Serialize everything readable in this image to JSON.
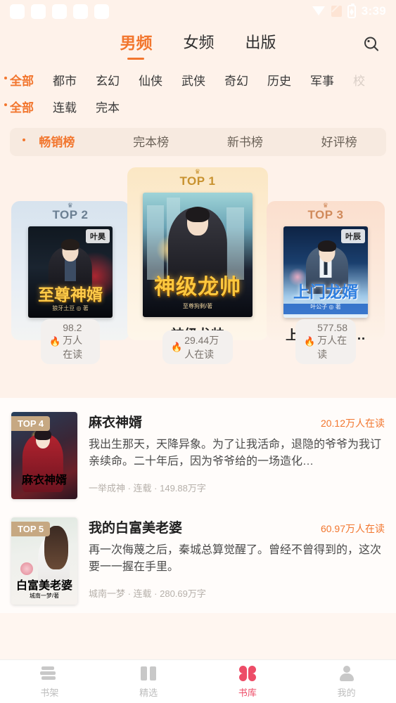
{
  "statusbar": {
    "time": "3:39",
    "placeholder_count": 5,
    "icons": [
      "wifi-icon",
      "signal-icon",
      "battery-charging-icon"
    ]
  },
  "header": {
    "tabs": [
      {
        "label": "男频",
        "active": true
      },
      {
        "label": "女频",
        "active": false
      },
      {
        "label": "出版",
        "active": false
      }
    ],
    "search_icon": "search-icon"
  },
  "filters": {
    "genre_row": [
      {
        "label": "全部",
        "selected": true
      },
      {
        "label": "都市",
        "selected": false
      },
      {
        "label": "玄幻",
        "selected": false
      },
      {
        "label": "仙侠",
        "selected": false
      },
      {
        "label": "武侠",
        "selected": false
      },
      {
        "label": "奇幻",
        "selected": false
      },
      {
        "label": "历史",
        "selected": false
      },
      {
        "label": "军事",
        "selected": false
      },
      {
        "label": "校",
        "selected": false,
        "clipped": true
      }
    ],
    "status_row": [
      {
        "label": "全部",
        "selected": true
      },
      {
        "label": "连载",
        "selected": false
      },
      {
        "label": "完本",
        "selected": false
      }
    ]
  },
  "rank_tabs": [
    {
      "label": "畅销榜",
      "selected": true
    },
    {
      "label": "完本榜",
      "selected": false
    },
    {
      "label": "新书榜",
      "selected": false
    },
    {
      "label": "好评榜",
      "selected": false
    }
  ],
  "podium": [
    {
      "rank_label": "TOP 2",
      "title": "至尊神婿",
      "author_badge": "叶昊",
      "cover_title": "至尊神婿",
      "cover_sub": "狼牙土豆 ◎ 著",
      "heat": "98.2万人在读"
    },
    {
      "rank_label": "TOP 1",
      "title": "神级龙帅",
      "author_badge": "",
      "cover_title": "神级龙帅",
      "cover_sub": "至尊狗剩/著",
      "heat": "29.44万人在读"
    },
    {
      "rank_label": "TOP 3",
      "title": "上门龙婿（…",
      "author_badge": "叶辰",
      "cover_title": "上门龙婿",
      "cover_sub": "叶公子 ◎ 著",
      "heat": "577.58万人在读"
    }
  ],
  "list": [
    {
      "badge": "TOP 4",
      "title": "麻衣神婿",
      "heat": "20.12万人在读",
      "desc": "我出生那天，天降异象。为了让我活命，退隐的爷爷为我订亲续命。二十年后，因为爷爷给的一场造化…",
      "meta": "一举成神 · 连载 · 149.88万字",
      "cover_title": "麻衣神婿"
    },
    {
      "badge": "TOP 5",
      "title": "我的白富美老婆",
      "heat": "60.97万人在读",
      "desc": "再一次侮蔑之后，秦城总算觉醒了。曾经不曾得到的，这次要一一握在手里。",
      "meta": "城南一梦 · 连载 · 280.69万字",
      "cover_title": "白富美老婆",
      "cover_sub": "城南一梦/著"
    }
  ],
  "bottom_nav": [
    {
      "label": "书架",
      "icon": "bookshelf-icon",
      "active": false
    },
    {
      "label": "精选",
      "icon": "open-book-icon",
      "active": false
    },
    {
      "label": "书库",
      "icon": "clover-library-icon",
      "active": true
    },
    {
      "label": "我的",
      "icon": "user-profile-icon",
      "active": false
    }
  ],
  "colors": {
    "accent": "#F2762E",
    "nav_active": "#ED4C67",
    "bg": "#FEF2EA",
    "list_bg": "#FFFCFA"
  },
  "icons": {
    "flame": "🔥",
    "crown": "♛"
  }
}
